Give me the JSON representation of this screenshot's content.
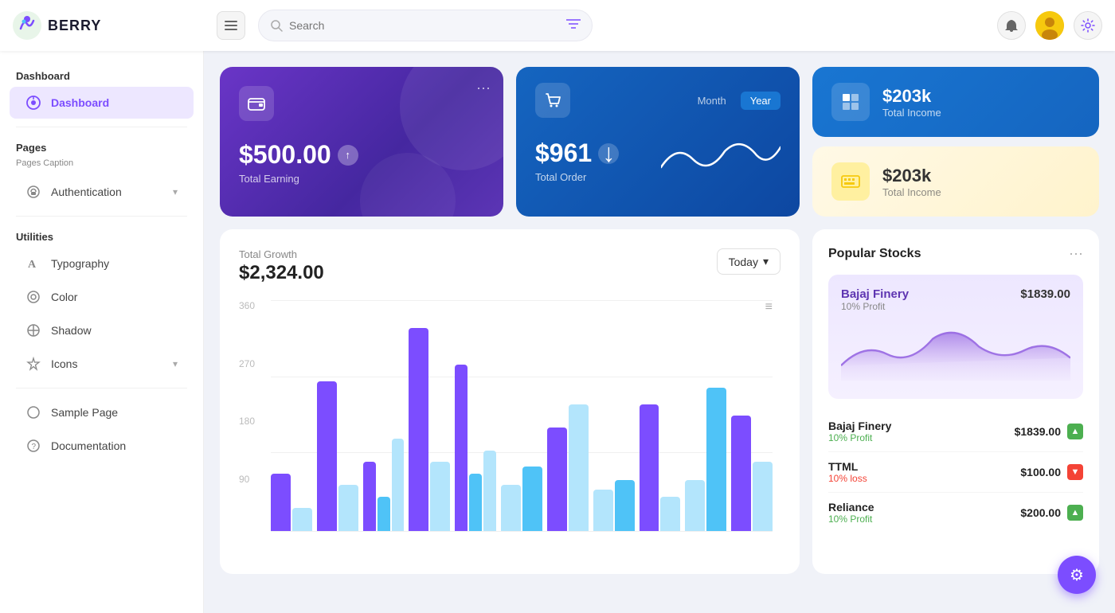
{
  "header": {
    "logo_text": "BERRY",
    "search_placeholder": "Search",
    "hamburger_label": "☰"
  },
  "sidebar": {
    "section_dashboard": "Dashboard",
    "active_item": "Dashboard",
    "active_item_icon": "⊙",
    "section_pages": "Pages",
    "pages_caption": "Pages Caption",
    "auth_item": "Authentication",
    "auth_icon": "🔗",
    "section_utilities": "Utilities",
    "typography_item": "Typography",
    "typography_icon": "A",
    "color_item": "Color",
    "color_icon": "◎",
    "shadow_item": "Shadow",
    "shadow_icon": "⊘",
    "icons_item": "Icons",
    "icons_icon": "✦",
    "sample_page_item": "Sample Page",
    "sample_page_icon": "◯",
    "documentation_item": "Documentation",
    "documentation_icon": "?"
  },
  "cards": {
    "earning_amount": "$500.00",
    "earning_label": "Total Earning",
    "order_amount": "$961",
    "order_label": "Total Order",
    "month_btn": "Month",
    "year_btn": "Year",
    "income_blue_amount": "$203k",
    "income_blue_label": "Total Income",
    "income_yellow_amount": "$203k",
    "income_yellow_label": "Total Income"
  },
  "chart": {
    "title": "Total Growth",
    "amount": "$2,324.00",
    "today_btn": "Today",
    "y_labels": [
      "360",
      "270",
      "180",
      "90",
      ""
    ],
    "menu_icon": "≡"
  },
  "stocks": {
    "title": "Popular Stocks",
    "more_icon": "···",
    "featured": {
      "name": "Bajaj Finery",
      "price": "$1839.00",
      "profit": "10% Profit"
    },
    "list": [
      {
        "name": "Bajaj Finery",
        "price": "$1839.00",
        "change": "10% Profit",
        "up": true
      },
      {
        "name": "TTML",
        "price": "$100.00",
        "change": "10% loss",
        "up": false
      },
      {
        "name": "Reliance",
        "price": "$200.00",
        "change": "10% Profit",
        "up": true
      }
    ]
  },
  "fab": {
    "icon": "⚙"
  }
}
